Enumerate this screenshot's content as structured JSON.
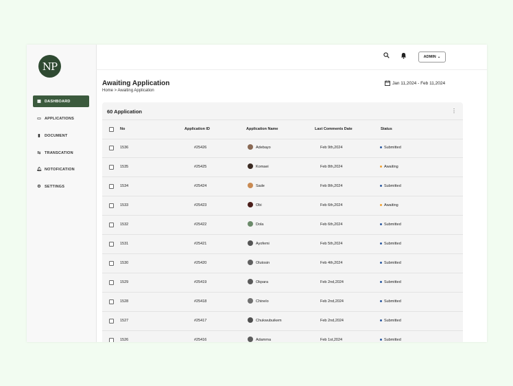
{
  "logo": {
    "text": "NP"
  },
  "sidebar": {
    "items": [
      {
        "label": "DASHBOARD",
        "icon": "grid-icon",
        "glyph": "▦",
        "active": true
      },
      {
        "label": "APPLICATIONS",
        "icon": "inbox-icon",
        "glyph": "▭",
        "active": false
      },
      {
        "label": "DOCUMENT",
        "icon": "document-icon",
        "glyph": "▮",
        "active": false
      },
      {
        "label": "TRANSCATION",
        "icon": "transaction-icon",
        "glyph": "⇆",
        "active": false
      },
      {
        "label": "NOTOFICATION",
        "icon": "bell-icon",
        "glyph": "🔔︎",
        "active": false
      },
      {
        "label": "SETTINGS",
        "icon": "gear-icon",
        "glyph": "⚙",
        "active": false
      }
    ]
  },
  "topbar": {
    "admin_label": "ADMIN"
  },
  "page": {
    "title": "Awaiting Application",
    "breadcrumb": "Home > Awaiting Application",
    "date_range": "Jan 11,2024 - Feb 11,2024"
  },
  "table": {
    "title": "60 Application",
    "columns": {
      "no": "No",
      "id": "Application ID",
      "name": "Application Name",
      "date": "Last Comments Date",
      "status": "Status"
    },
    "rows": [
      {
        "no": "1536",
        "id": "#25426",
        "name": "Adebayo",
        "date": "Feb 9th,2024",
        "status": "Submitted",
        "avatar_color": "#8a6a55"
      },
      {
        "no": "1535",
        "id": "#25425",
        "name": "Komaei",
        "date": "Feb 8th,2024",
        "status": "Awaiting",
        "avatar_color": "#3a2a22"
      },
      {
        "no": "1534",
        "id": "#25424",
        "name": "Sade",
        "date": "Feb 8th,2024",
        "status": "Submitted",
        "avatar_color": "#c98a52"
      },
      {
        "no": "1533",
        "id": "#25423",
        "name": "Obi",
        "date": "Feb 6th,2024",
        "status": "Awaiting",
        "avatar_color": "#4a1e1a"
      },
      {
        "no": "1532",
        "id": "#25422",
        "name": "Dola",
        "date": "Feb 6th,2024",
        "status": "Submitted",
        "avatar_color": "#6b8a6a"
      },
      {
        "no": "1531",
        "id": "#25421",
        "name": "Ayofemi",
        "date": "Feb 5th,2024",
        "status": "Submitted",
        "avatar_color": "#555555"
      },
      {
        "no": "1530",
        "id": "#25420",
        "name": "Olutosin",
        "date": "Feb 4th,2024",
        "status": "Submitted",
        "avatar_color": "#606060"
      },
      {
        "no": "1529",
        "id": "#25419",
        "name": "Okpara",
        "date": "Feb 2nd,2024",
        "status": "Submitted",
        "avatar_color": "#5a5a5a"
      },
      {
        "no": "1528",
        "id": "#25418",
        "name": "Chinelo",
        "date": "Feb 2nd,2024",
        "status": "Submitted",
        "avatar_color": "#707070"
      },
      {
        "no": "1527",
        "id": "#25417",
        "name": "Chukwubuikem",
        "date": "Feb 2nd,2024",
        "status": "Submitted",
        "avatar_color": "#505050"
      },
      {
        "no": "1526",
        "id": "#25416",
        "name": "Adamma",
        "date": "Feb 1st,2024",
        "status": "Submitted",
        "avatar_color": "#5c5c5c"
      }
    ]
  },
  "colors": {
    "accent": "#3b5a3d",
    "submitted": "#2c5aa0",
    "awaiting": "#f0a030"
  }
}
